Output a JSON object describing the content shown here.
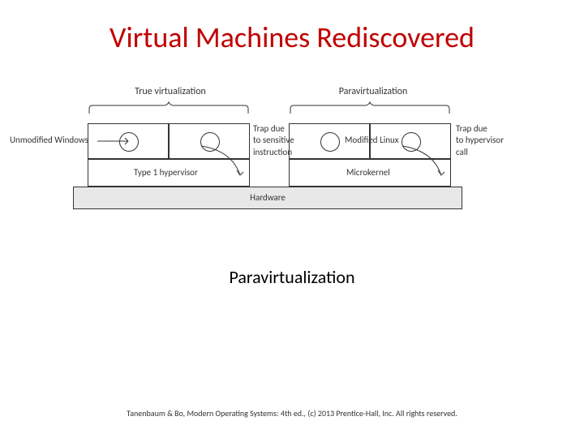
{
  "title": "Virtual Machines Rediscovered",
  "diagram": {
    "top_labels": {
      "left": "True virtualization",
      "right": "Paravirtualization"
    },
    "os_labels": {
      "left": "Unmodified Windows",
      "right": "Modified Linux"
    },
    "hv_labels": {
      "left": "Type 1 hypervisor",
      "right": "Microkernel"
    },
    "side_labels": {
      "mid": "Trap due\nto sensitive\ninstruction",
      "right": "Trap due\nto hypervisor\ncall"
    },
    "hardware": "Hardware"
  },
  "subtitle": "Paravirtualization",
  "footer": "Tanenbaum & Bo, Modern Operating Systems: 4th ed., (c) 2013 Prentice-Hall, Inc. All rights reserved."
}
